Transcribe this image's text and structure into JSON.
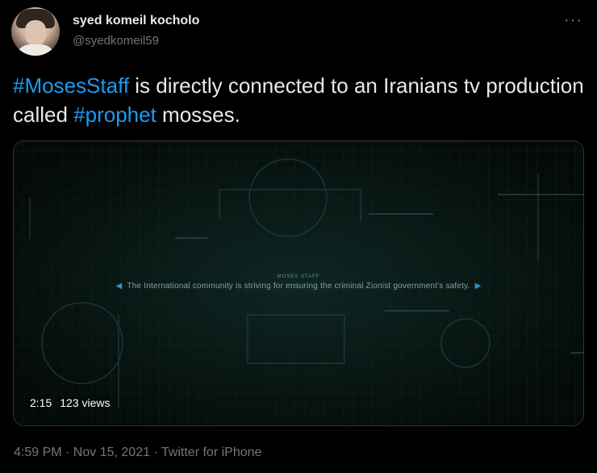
{
  "user": {
    "display_name": "syed komeil kocholo",
    "handle": "@syedkomeil59"
  },
  "tweet": {
    "segments": [
      {
        "text": "#MosesStaff",
        "hashtag": true
      },
      {
        "text": " is directly connected  to an Iranians tv production called ",
        "hashtag": false
      },
      {
        "text": "#prophet",
        "hashtag": true
      },
      {
        "text": " mosses.",
        "hashtag": false
      }
    ]
  },
  "media": {
    "brand": "MOSES STAFF",
    "caption": "The International community is striving for ensuring the criminal Zionist government's safety.",
    "duration": "2:15",
    "views": "123 views"
  },
  "meta": {
    "timestamp": "4:59 PM · Nov 15, 2021 · Twitter for iPhone"
  },
  "colors": {
    "background": "#000000",
    "accent": "#1d9bf0",
    "muted": "#71767b"
  },
  "icons": {
    "more": "more-horizontal-icon",
    "caption_left": "triangle-left-icon",
    "caption_right": "triangle-right-icon"
  }
}
